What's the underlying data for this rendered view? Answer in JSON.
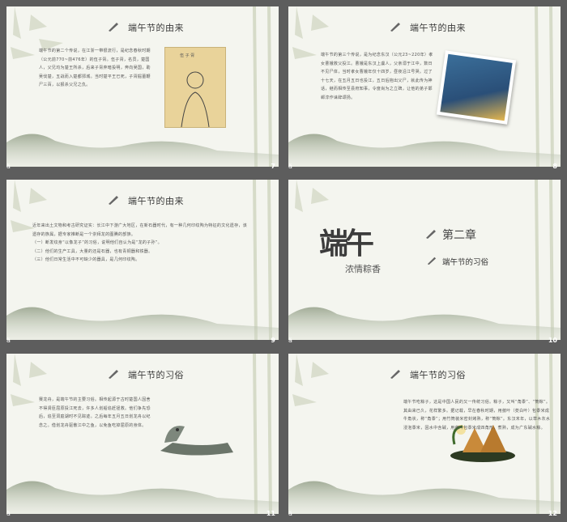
{
  "slides": [
    {
      "title": "端午节的由来",
      "number": "7",
      "body": "端午节的第二个传说，在江浙一带很流行，是纪念春秋时期（公元前770~前476年）的伍子胥。伍子胥，名员，楚国人，父兄均为楚王所杀，后来子胥弃暗投明，奔向吴国，助吴伐楚，五战而入楚都郢城。当时楚平王已死，子胥掘墓鞭尸三百，以报杀父兄之仇。",
      "portrait_caption": "伍 子 胥"
    },
    {
      "title": "端午节的由来",
      "number": "8",
      "body": "端午节的第三个传说，是为纪念东汉（公元23~220年）孝女曹娥救父投江。曹娥是东汉上虞人，父亲溺于江中，数日不见尸体，当时孝女曹娥年仅十四岁，昼夜沿江号哭。过了十七天，在五月五日也投江，五日后抱出父尸，就此传为神话，继而相传至县府知事，令度尚为之立碑，让他的弟子邯郸淳作诔辞颂扬。"
    },
    {
      "title": "端午节的由来",
      "number": "9",
      "body": [
        "近年来出土文物和考古研究证实：长江中下游广大地区，在新石器时代，有一种几何印纹陶为特征的文化遗存，该遗存的族属，据专家推断是一个崇拜龙的图腾的部族。",
        "（一）断发纹身“以像龙子”的习俗，说明他们自认为是“龙的子孙”。",
        "（二）他们的生产工具，大量的还是石器，也有青铜器和铁器。",
        "（三）他们日常生活中不可缺少的器具，是几何印纹陶。"
      ]
    },
    {
      "number": "10",
      "logo_big": "端午",
      "logo_sub": "浓情粽香",
      "chapter": "第二章",
      "chapter_sub": "端午节的习俗"
    },
    {
      "title": "端午节的习俗",
      "number": "11",
      "body": "赛龙舟，是端午节的主要习俗。相传起源于古时楚国人因舍不得贤臣屈原投江死去，许多人划船追赶拯救。他们争先恐后，追至洞庭湖时不见踪迹。之后每年五月五日划龙舟以纪念之。借划龙舟驱散江中之鱼，以免鱼吃掉屈原的身体。"
    },
    {
      "title": "端午节的习俗",
      "number": "12",
      "body": "端午节吃粽子，这是中国人民的又一传统习俗。粽子，又叫“角黍”、“筒粽”。其由来已久，花样繁多。据记载，早在春秋时期，用菰叶（茭白叶）包黍米成牛角状，称“角黍”；用竹筒装米密封烤熟，称“筒粽”。东汉末年，以草木灰水浸泡黍米，因水中含碱，用菰叶包黍米成四角形，煮熟，成为广东碱水粽。"
    }
  ],
  "footer_symbol": "ä"
}
